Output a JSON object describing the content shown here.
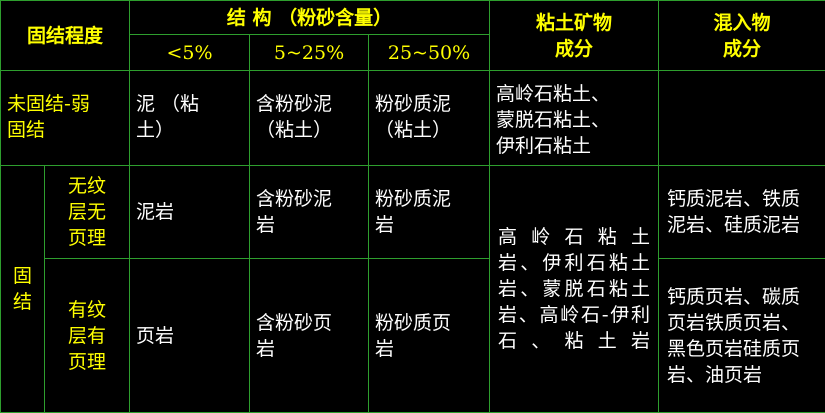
{
  "header": {
    "degree": "固结程度",
    "structure": "结 构 （粉砂含量）",
    "clay_minerals": "粘土矿物\n成分",
    "admixture": "混入物\n成分",
    "ranges": [
      "<5%",
      "5~25%",
      "25~50%"
    ]
  },
  "rows": {
    "weak": {
      "degree": "未固结-弱\n固结",
      "lt5": "泥 （粘\n土）",
      "r5_25": "含粉砂泥\n（粘土）",
      "r25_50": "粉砂质泥\n（粘土）",
      "minerals": "高岭石粘土、\n蒙脱石粘土、\n伊利石粘土",
      "admixture": ""
    },
    "consolidated": {
      "label": "固\n结",
      "minerals": "高 岭 石 粘 土 岩、伊利石粘土岩、蒙脱石粘土岩、高岭石-伊利石、粘土岩",
      "unlaminated": {
        "sub": "无纹\n层无\n页理",
        "lt5": "泥岩",
        "r5_25": "含粉砂泥\n岩",
        "r25_50": "粉砂质泥\n岩",
        "admixture": "钙质泥岩、铁质泥岩、硅质泥岩"
      },
      "laminated": {
        "sub": "有纹\n层有\n页理",
        "lt5": "页岩",
        "r5_25": "含粉砂页\n岩",
        "r25_50": "粉砂质页\n岩",
        "admixture": "钙质页岩、碳质页岩铁质页岩、黑色页岩硅质页岩、油页岩"
      }
    }
  },
  "colors": {
    "background": "#000000",
    "border": "#2e9e2e",
    "header_text": "#ffff00",
    "body_text": "#ffffff"
  }
}
